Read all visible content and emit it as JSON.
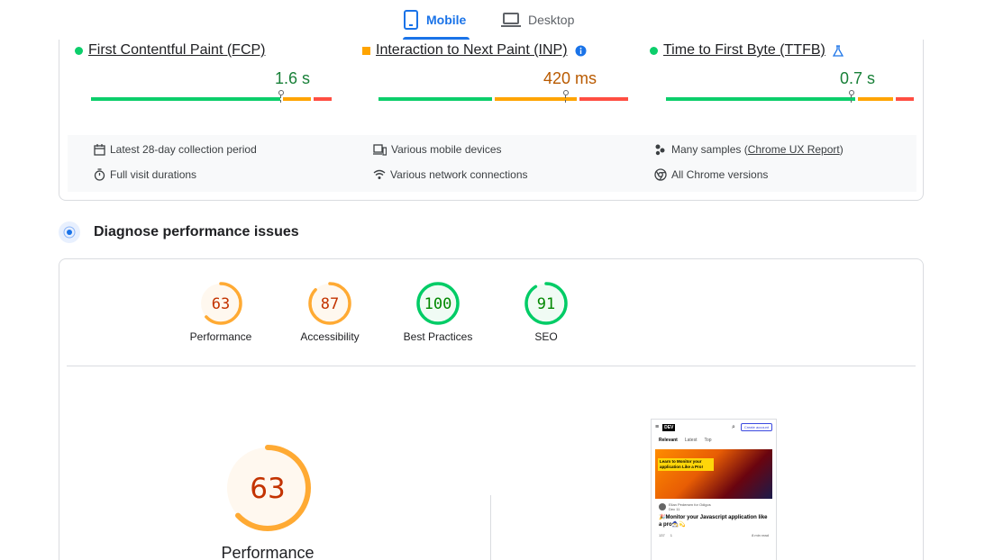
{
  "tabs": {
    "mobile": "Mobile",
    "desktop": "Desktop"
  },
  "metrics": [
    {
      "name": "First Contentful Paint (FCP)",
      "value": "1.6 s",
      "status": "good",
      "status_color": "#0cce6b",
      "value_color": "#188038",
      "segments": [
        {
          "color": "#0cce6b",
          "w": 210
        },
        {
          "color": "#ffa400",
          "w": 31
        },
        {
          "color": "#ff4e42",
          "w": 20
        }
      ],
      "marker_fraction": 0.79
    },
    {
      "name": "Interaction to Next Paint (INP)",
      "value": "420 ms",
      "status": "needs-improvement",
      "status_color": "#ffa400",
      "value_color": "#b95a00",
      "segments": [
        {
          "color": "#0cce6b",
          "w": 126
        },
        {
          "color": "#ffa400",
          "w": 91
        },
        {
          "color": "#ff4e42",
          "w": 54
        }
      ],
      "marker_fraction": 0.75,
      "info_icon": "info-icon"
    },
    {
      "name": "Time to First Byte (TTFB)",
      "value": "0.7 s",
      "status": "good",
      "status_color": "#0cce6b",
      "value_color": "#188038",
      "segments": [
        {
          "color": "#0cce6b",
          "w": 210
        },
        {
          "color": "#ffa400",
          "w": 39
        },
        {
          "color": "#ff4e42",
          "w": 20
        }
      ],
      "marker_fraction": 0.75,
      "experimental_icon": "flask-icon"
    }
  ],
  "info": {
    "period": "Latest 28-day collection period",
    "devices": "Various mobile devices",
    "samples_prefix": "Many samples (",
    "samples_link": "Chrome UX Report",
    "samples_suffix": ")",
    "durations": "Full visit durations",
    "network": "Various network connections",
    "versions": "All Chrome versions"
  },
  "diagnose": {
    "title": "Diagnose performance issues"
  },
  "scores": [
    {
      "label": "Performance",
      "score": "63",
      "value": 0.63,
      "color": "#fa3",
      "text_color": "#c33300",
      "fill": "#fff8ef"
    },
    {
      "label": "Accessibility",
      "score": "87",
      "value": 0.87,
      "color": "#fa3",
      "text_color": "#c33300",
      "fill": "#fff8ef"
    },
    {
      "label": "Best Practices",
      "score": "100",
      "value": 1.0,
      "color": "#0c6",
      "text_color": "#008800",
      "fill": "#f0fbf4"
    },
    {
      "label": "SEO",
      "score": "91",
      "value": 0.91,
      "color": "#0c6",
      "text_color": "#008800",
      "fill": "#f0fbf4"
    }
  ],
  "performance": {
    "score": "63",
    "value": 0.63,
    "label": "Performance"
  },
  "thumbnail": {
    "logo": "DEV",
    "create_account": "Create account",
    "tab_relevant": "Relevant",
    "tab_latest": "Latest",
    "tab_top": "Top",
    "banner": "Learn to Monitor your application Like a Pro!",
    "author": "Elian Pedersen for Odigos",
    "date": "Dec 11",
    "post_title": "🎉Monitor your Javascript application like a pro🧙‍♂️💫",
    "reactions": "137",
    "comments": "1",
    "read_time": "8 min read"
  }
}
